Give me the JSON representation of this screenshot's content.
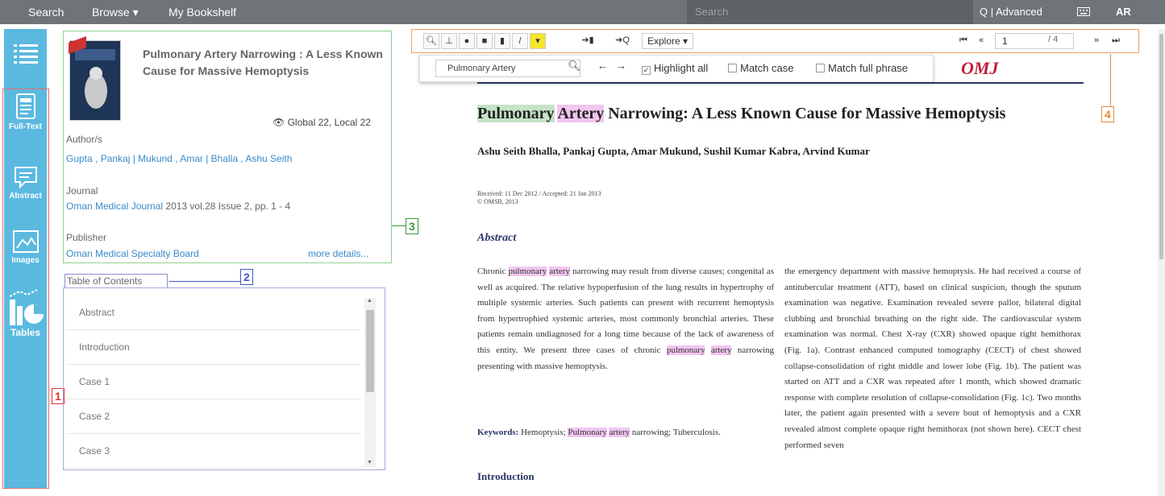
{
  "topnav": {
    "search": "Search",
    "browse": "Browse",
    "bookshelf": "My Bookshelf",
    "search_placeholder": "Search",
    "advanced": "Q | Advanced",
    "lang": "AR"
  },
  "sidebar": {
    "items": [
      {
        "label": ""
      },
      {
        "label": "Full-Text"
      },
      {
        "label": "Abstract"
      },
      {
        "label": "Images"
      },
      {
        "label": "Tables"
      }
    ]
  },
  "callouts": {
    "one": "1",
    "two": "2",
    "three": "3",
    "four": "4"
  },
  "info": {
    "title": "Pulmonary Artery Narrowing : A Less Known Cause for Massive Hemoptysis",
    "views": "Global 22, Local 22",
    "authors_label": "Author/s",
    "authors": "Gupta , Pankaj | Mukund , Amar | Bhalla , Ashu Seith",
    "journal_label": "Journal",
    "journal_name": "Oman Medical Journal",
    "journal_details": "2013 vol.28 Issue 2, pp. 1 - 4",
    "publisher_label": "Publisher",
    "publisher": "Oman Medical Specialty Board",
    "more": "more details..."
  },
  "toc": {
    "label": "Table of Contents",
    "items": [
      "Abstract",
      "Introduction",
      "Case 1",
      "Case 2",
      "Case 3"
    ]
  },
  "toolbar": {
    "explore": "Explore ▾",
    "page": "1",
    "total": "/ 4"
  },
  "find": {
    "query": "Pulmonary Artery",
    "highlight_all": "Highlight all",
    "match_case": "Match case",
    "match_phrase": "Match full phrase"
  },
  "doc": {
    "logo": "OMJ",
    "title_w1": "Pulmonary",
    "title_w2": "Artery",
    "title_rest": " Narrowing: A Less Known Cause for Massive Hemoptysis",
    "authors": "Ashu Seith Bhalla, Pankaj Gupta, Amar Mukund, Sushil Kumar Kabra, Arvind Kumar",
    "received": "Received: 11 Dec 2012 / Accepted: 21 Jan 2013",
    "copyright": "© OMSB, 2013",
    "abstract_head": "Abstract",
    "col1_a": "Chronic ",
    "col1_hl1": "pulmonary",
    "col1_hl2": "artery",
    "col1_b": " narrowing may result from diverse causes; congenital as well as acquired. The relative hypoperfusion of the lung results in hypertrophy of multiple systemic arteries. Such patients can present with recurrent hemoptysis from hypertrophied systemic arteries, most commonly bronchial arteries. These patients remain undiagnosed for a long time because of the lack of awareness of this entity. We present three cases of chronic ",
    "col1_hl3": "pulmonary",
    "col1_hl4": "artery",
    "col1_c": " narrowing presenting with massive hemoptysis.",
    "kw_label": "Keywords:",
    "kw_a": " Hemoptysis; ",
    "kw_hl1": "Pulmonary",
    "kw_hl2": "artery",
    "kw_b": " narrowing; Tuberculosis.",
    "col2": "the emergency department with massive hemoptysis. He had received a course of antitubercular treatment (ATT), based on clinical suspicion, though the sputum examination was negative. Examination revealed severe pallor, bilateral digital clubbing and bronchial breathing on the right side. The cardiovascular system examination was normal. Chest X-ray (CXR) showed opaque right hemithorax (Fig. 1a). Contrast enhanced computed tomography (CECT) of chest showed collapse-consolidation of right middle and lower lobe (Fig. 1b). The patient was started on ATT and a CXR was repeated after 1 month, which showed dramatic response with complete resolution of collapse-consolidation (Fig. 1c). Two months later, the patient again presented with a severe bout of hemoptysis and a CXR revealed almost complete opaque right hemithorax (not shown here). CECT chest performed seven",
    "intro_head": "Introduction"
  }
}
